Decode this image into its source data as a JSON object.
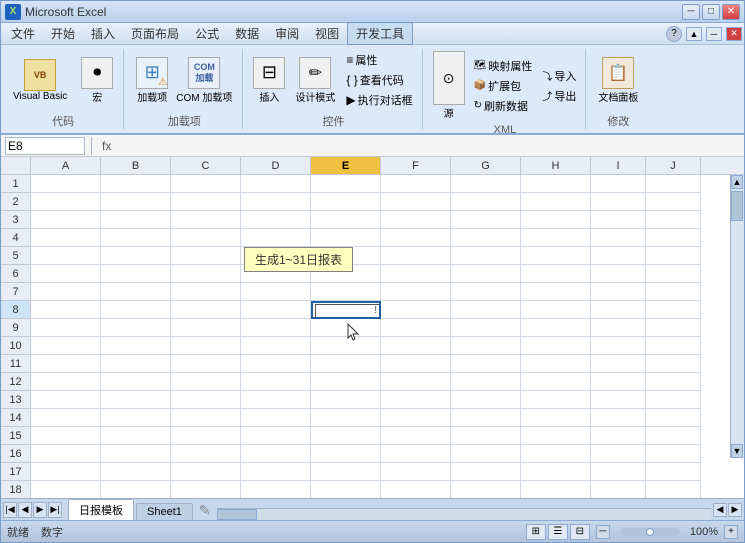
{
  "titleBar": {
    "title": "Microsoft Excel",
    "minimize": "─",
    "restore": "□",
    "close": "✕"
  },
  "menuBar": {
    "items": [
      "文件",
      "开始",
      "插入",
      "页面布局",
      "公式",
      "数据",
      "审阅",
      "视图",
      "开发工具"
    ]
  },
  "ribbon": {
    "activeTab": "开发工具",
    "groups": {
      "code": {
        "label": "代码",
        "buttons": [
          {
            "id": "visual-basic",
            "label": "Visual Basic"
          },
          {
            "id": "macro",
            "label": "宏"
          }
        ]
      },
      "addins": {
        "label": "加载项",
        "buttons": [
          {
            "id": "addins",
            "label": "加载项"
          },
          {
            "id": "com-addins",
            "label": "COM 加载项"
          }
        ]
      },
      "controls": {
        "label": "控件",
        "buttons": [
          {
            "id": "insert",
            "label": "插入"
          },
          {
            "id": "design-mode",
            "label": "设计模式"
          },
          {
            "id": "properties",
            "label": "属性"
          },
          {
            "id": "view-code",
            "label": "查看代码"
          },
          {
            "id": "run-dialog",
            "label": "执行对话框"
          }
        ]
      },
      "xml": {
        "label": "XML",
        "buttons": [
          {
            "id": "source",
            "label": "源"
          },
          {
            "id": "map-props",
            "label": "映射属性"
          },
          {
            "id": "expansion-packs",
            "label": "扩展包"
          },
          {
            "id": "refresh-data",
            "label": "刷新数据"
          },
          {
            "id": "import",
            "label": "导入"
          },
          {
            "id": "export",
            "label": "导出"
          }
        ]
      },
      "modify": {
        "label": "修改",
        "buttons": [
          {
            "id": "document-panel",
            "label": "文档面板"
          }
        ]
      }
    }
  },
  "formulaBar": {
    "cellRef": "E8",
    "formula": ""
  },
  "grid": {
    "columns": [
      "A",
      "B",
      "C",
      "D",
      "E",
      "F",
      "G",
      "H",
      "I",
      "J"
    ],
    "activeCell": "E8",
    "activeCol": "E",
    "rows": 18,
    "tooltip": {
      "text": "生成1~31日报表",
      "row": 5,
      "col": "D"
    },
    "inputControl": {
      "row": 8,
      "col": "E"
    }
  },
  "sheetTabs": {
    "sheets": [
      "日报模板",
      "Sheet1"
    ],
    "active": "日报模板"
  },
  "statusBar": {
    "ready": "就绪",
    "mode": "数字",
    "viewModes": [
      "normal",
      "page-layout",
      "page-break"
    ],
    "zoom": "100%",
    "zoomMinus": "─",
    "zoomPlus": "+"
  }
}
